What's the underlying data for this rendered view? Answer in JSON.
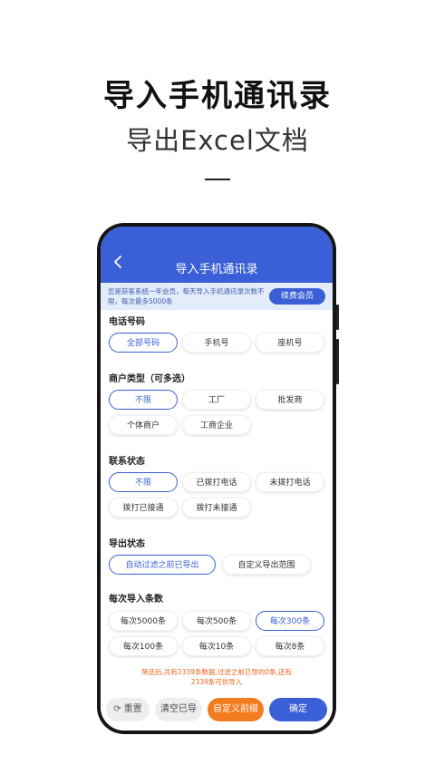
{
  "promo": {
    "title": "导入手机通讯录",
    "subtitle": "导出Excel文档"
  },
  "appbar": {
    "title": "导入手机通讯录",
    "back_icon": "chevron-left-icon"
  },
  "notice": {
    "text": "您是获客系统一年会员，每天导入手机通讯录次数不限，每次最多5000条",
    "renew_label": "续费会员"
  },
  "sections": {
    "phone": {
      "label": "电话号码",
      "options": [
        "全部号码",
        "手机号",
        "座机号"
      ],
      "selected": "全部号码"
    },
    "merchant": {
      "label": "商户类型（可多选）",
      "options": [
        "不限",
        "工厂",
        "批发商",
        "个体商户",
        "工商企业"
      ],
      "selected": "不限"
    },
    "contact": {
      "label": "联系状态",
      "options": [
        "不限",
        "已拨打电话",
        "未拨打电话",
        "拨打已接通",
        "拨打未接通"
      ],
      "selected": "不限"
    },
    "export": {
      "label": "导出状态",
      "options": [
        "自动过滤之前已导出",
        "自定义导出范围"
      ],
      "selected": "自动过滤之前已导出"
    },
    "count": {
      "label": "每次导入条数",
      "options": [
        "每次5000条",
        "每次500条",
        "每次300条",
        "每次100条",
        "每次10条",
        "每次8条"
      ],
      "selected": "每次300条"
    }
  },
  "summary": {
    "line1": "筛选后,共有2339条数据,过滤之前已导的0条,还有",
    "line2": "2339条可供导入"
  },
  "bottom": {
    "reset_label": "重置",
    "reset_icon": "refresh-icon",
    "clear_label": "清空已导",
    "custom_label": "自定义前缀",
    "confirm_label": "确定"
  },
  "colors": {
    "primary": "#3a5fd6",
    "accent": "#f47c20",
    "notice_bg": "#e3ecfb",
    "summary_text": "#e8641b"
  }
}
